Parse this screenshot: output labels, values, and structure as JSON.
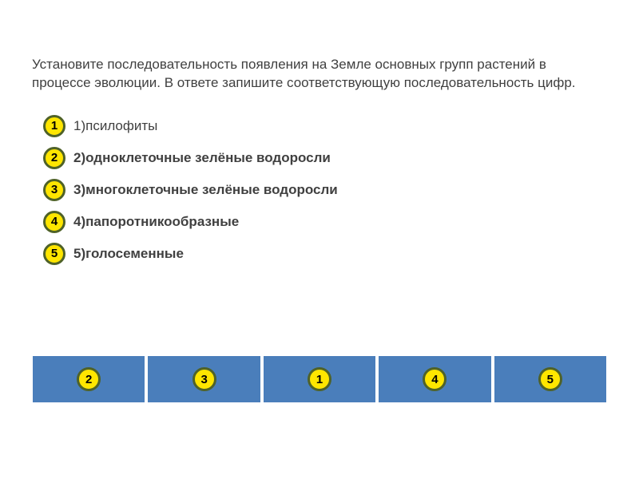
{
  "question": "Установите последовательность появления на Земле основных групп растений в процессе эволюции. В ответе запишите соответствующую последовательность цифр.",
  "options": [
    {
      "num": "1",
      "text": "1)псилофиты",
      "bold": false
    },
    {
      "num": "2",
      "text": "2)одноклеточные зелёные водоросли",
      "bold": true
    },
    {
      "num": "3",
      "text": "3)многоклеточные зелёные водоросли",
      "bold": true
    },
    {
      "num": "4",
      "text": "4)папоротникообразные",
      "bold": true
    },
    {
      "num": "5",
      "text": "5)голосеменные",
      "bold": true
    }
  ],
  "answer_sequence": [
    "2",
    "3",
    "1",
    "4",
    "5"
  ]
}
